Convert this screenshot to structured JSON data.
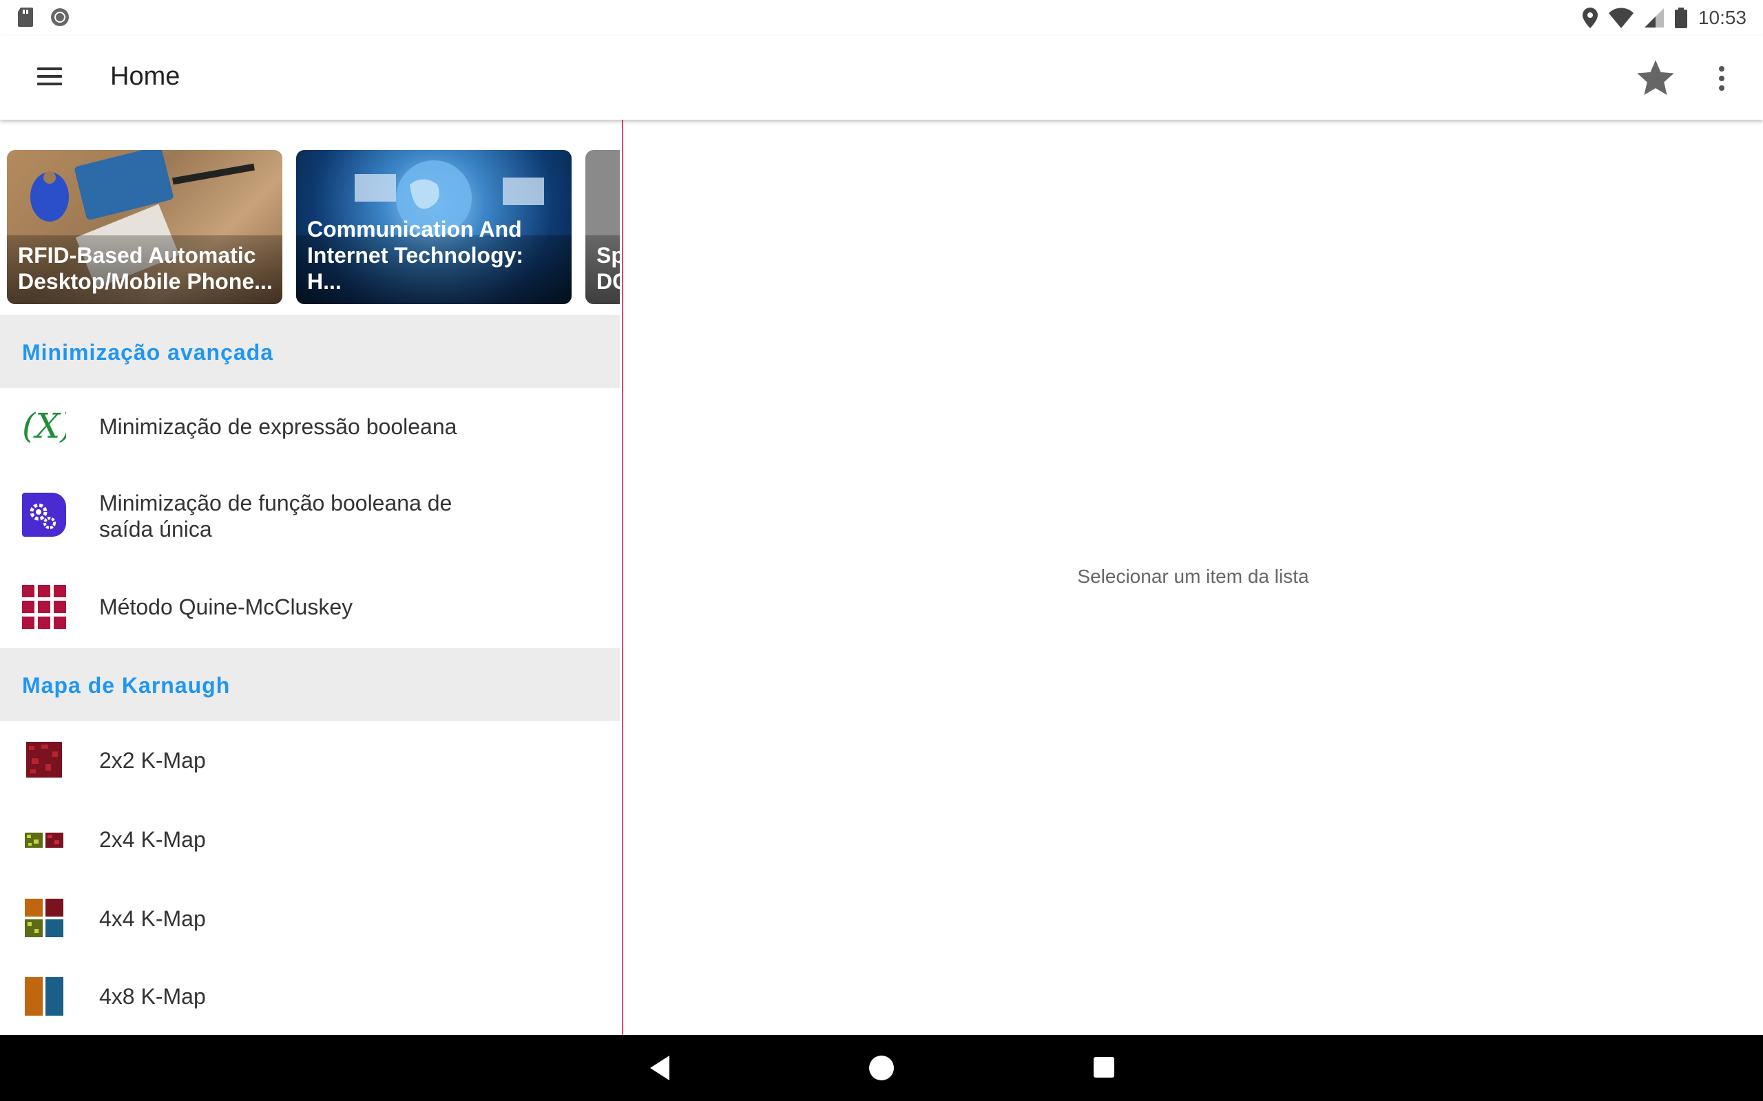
{
  "status_bar": {
    "time": "10:53"
  },
  "toolbar": {
    "title": "Home"
  },
  "cards": [
    {
      "title": "RFID-Based Automatic\nDesktop/Mobile Phone..."
    },
    {
      "title": "Communication And\nInternet Technology: H..."
    },
    {
      "title": "Sp\nDC"
    }
  ],
  "sections": [
    {
      "header": "Minimização avançada",
      "items": [
        {
          "label": "Minimização de expressão booleana",
          "icon": "function-x-icon"
        },
        {
          "label": "Minimização de função booleana de\nsaída única",
          "icon": "gears-icon"
        },
        {
          "label": "Método Quine-McCluskey",
          "icon": "grid-icon"
        }
      ]
    },
    {
      "header": "Mapa de Karnaugh",
      "items": [
        {
          "label": "2x2 K-Map",
          "icon": "kmap-2x2-icon"
        },
        {
          "label": "2x4 K-Map",
          "icon": "kmap-2x4-icon"
        },
        {
          "label": "4x4 K-Map",
          "icon": "kmap-4x4-icon"
        },
        {
          "label": "4x8 K-Map",
          "icon": "kmap-4x8-icon"
        }
      ]
    }
  ],
  "detail": {
    "empty_text": "Selecionar um item da lista"
  },
  "colors": {
    "accent": "#2196F3",
    "divider": "#e0457b",
    "section_bg": "#ececec"
  }
}
